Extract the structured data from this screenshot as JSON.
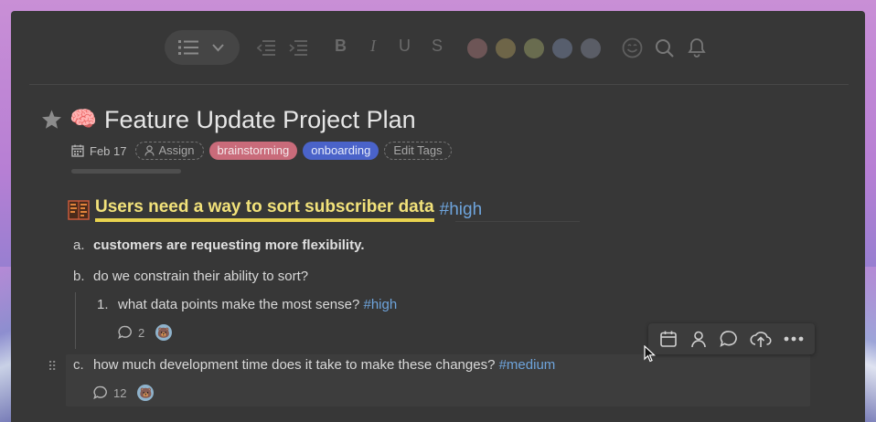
{
  "toolbar": {
    "list_button": {
      "icon": "bullet-list-icon",
      "dropdown_icon": "chevron-down-icon"
    },
    "indent": [
      "outdent-icon",
      "indent-icon"
    ],
    "format": {
      "bold": "B",
      "italic": "I",
      "underline": "U",
      "strike": "S"
    },
    "colors": [
      "#6d5556",
      "#6e6548",
      "#696c4f",
      "#575e6d",
      "#5a5d66"
    ],
    "right_icons": [
      "emoji-icon",
      "search-icon",
      "bell-icon"
    ]
  },
  "document": {
    "title_emoji": "🧠",
    "title": "Feature Update Project Plan",
    "date": "Feb 17",
    "assign_label": "Assign",
    "tags": [
      "brainstorming",
      "onboarding"
    ],
    "edit_tags_label": "Edit Tags",
    "progress": 0
  },
  "heading": {
    "text": "Users need a way to sort subscriber data",
    "tag": "#high"
  },
  "items": {
    "a": {
      "marker": "a.",
      "text": "customers are requesting more flexibility."
    },
    "b": {
      "marker": "b.",
      "text": "do we constrain their ability to sort?"
    },
    "b1": {
      "marker": "1.",
      "text": "what data points make the most sense?",
      "tag": "#high",
      "comments": "2"
    },
    "c": {
      "marker": "c.",
      "text": "how much development time does it take to make these changes?",
      "tag": "#medium",
      "comments": "12"
    }
  },
  "action_popover": [
    "calendar-icon",
    "assign-user-icon",
    "comment-icon",
    "upload-icon",
    "more-icon"
  ]
}
